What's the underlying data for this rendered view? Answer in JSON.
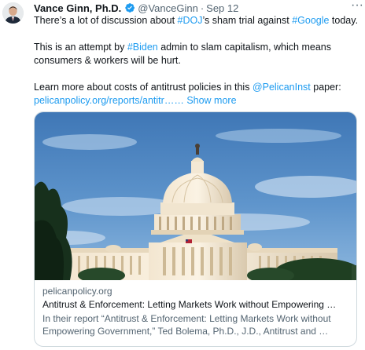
{
  "author": {
    "name": "Vance Ginn, Ph.D.",
    "handle": "@VanceGinn",
    "separator": "·",
    "date": "Sep 12",
    "avatar_icon": "profile-photo",
    "verified_icon": "verified-badge-icon",
    "verified_color": "#1d9bf0"
  },
  "more_label": "···",
  "body": {
    "line1": {
      "a": "There’s a lot of discussion about ",
      "hashtag1": "#DOJ",
      "b": "’s sham trial against ",
      "hashtag2": "#Google",
      "c": " today."
    },
    "line2": {
      "a": "This is an attempt by ",
      "hashtag": "#Biden",
      "b": " admin to slam capitalism, which means"
    },
    "line3": "consumers & workers will be hurt.",
    "line4": {
      "a": "Learn more about costs of antitrust policies in this ",
      "mention": "@PelicanInst",
      "b": " paper:"
    },
    "line5": {
      "url": "pelicanpolicy.org/reports/antitr……",
      "show_more": "Show more"
    },
    "link_color": "#1d9bf0"
  },
  "card": {
    "image_alt_icon": "us-capitol-photo",
    "domain": "pelicanpolicy.org",
    "title": "Antitrust & Enforcement: Letting Markets Work without Empowering …",
    "desc_line1": "In their report “Antitrust & Enforcement: Letting Markets Work without",
    "desc_line2": "Empowering Government,” Ted Bolema, Ph.D., J.D., Antitrust and …"
  }
}
